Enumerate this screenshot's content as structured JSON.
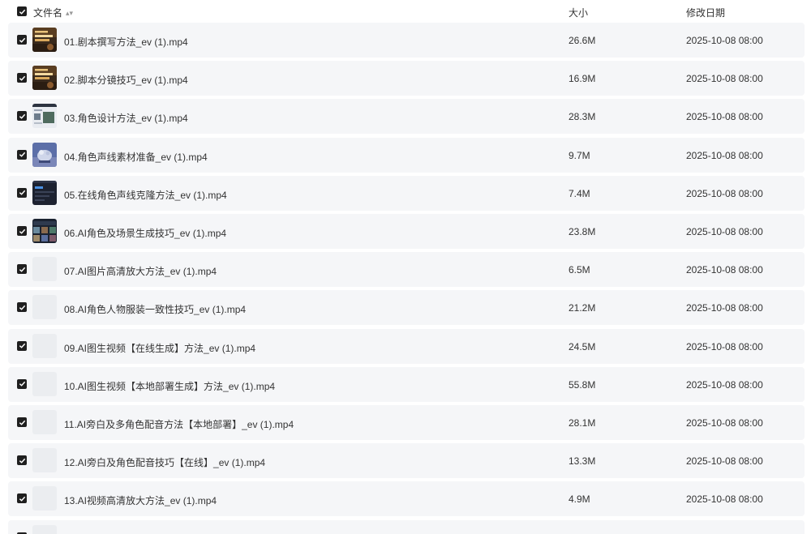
{
  "header": {
    "name_label": "文件名",
    "size_label": "大小",
    "date_label": "修改日期"
  },
  "files": [
    {
      "name": "01.剧本撰写方法_ev (1).mp4",
      "size": "26.6M",
      "date": "2025-10-08 08:00",
      "thumb": "poster"
    },
    {
      "name": "02.脚本分镜技巧_ev (1).mp4",
      "size": "16.9M",
      "date": "2025-10-08 08:00",
      "thumb": "poster"
    },
    {
      "name": "03.角色设计方法_ev (1).mp4",
      "size": "28.3M",
      "date": "2025-10-08 08:00",
      "thumb": "screen-light"
    },
    {
      "name": "04.角色声线素材准备_ev (1).mp4",
      "size": "9.7M",
      "date": "2025-10-08 08:00",
      "thumb": "creature"
    },
    {
      "name": "05.在线角色声线克隆方法_ev (1).mp4",
      "size": "7.4M",
      "date": "2025-10-08 08:00",
      "thumb": "screen-dark"
    },
    {
      "name": "06.AI角色及场景生成技巧_ev (1).mp4",
      "size": "23.8M",
      "date": "2025-10-08 08:00",
      "thumb": "screen-grid"
    },
    {
      "name": "07.AI图片高清放大方法_ev (1).mp4",
      "size": "6.5M",
      "date": "2025-10-08 08:00",
      "thumb": "blank"
    },
    {
      "name": "08.AI角色人物服装一致性技巧_ev (1).mp4",
      "size": "21.2M",
      "date": "2025-10-08 08:00",
      "thumb": "blank"
    },
    {
      "name": "09.AI图生视频【在线生成】方法_ev (1).mp4",
      "size": "24.5M",
      "date": "2025-10-08 08:00",
      "thumb": "blank"
    },
    {
      "name": "10.AI图生视频【本地部署生成】方法_ev (1).mp4",
      "size": "55.8M",
      "date": "2025-10-08 08:00",
      "thumb": "blank"
    },
    {
      "name": "11.AI旁白及多角色配音方法【本地部署】_ev (1).mp4",
      "size": "28.1M",
      "date": "2025-10-08 08:00",
      "thumb": "blank"
    },
    {
      "name": "12.AI旁白及角色配音技巧【在线】_ev (1).mp4",
      "size": "13.3M",
      "date": "2025-10-08 08:00",
      "thumb": "blank"
    },
    {
      "name": "13.AI视频高清放大方法_ev (1).mp4",
      "size": "4.9M",
      "date": "2025-10-08 08:00",
      "thumb": "blank"
    },
    {
      "name": "",
      "size": "",
      "date": "",
      "thumb": "blank"
    }
  ]
}
